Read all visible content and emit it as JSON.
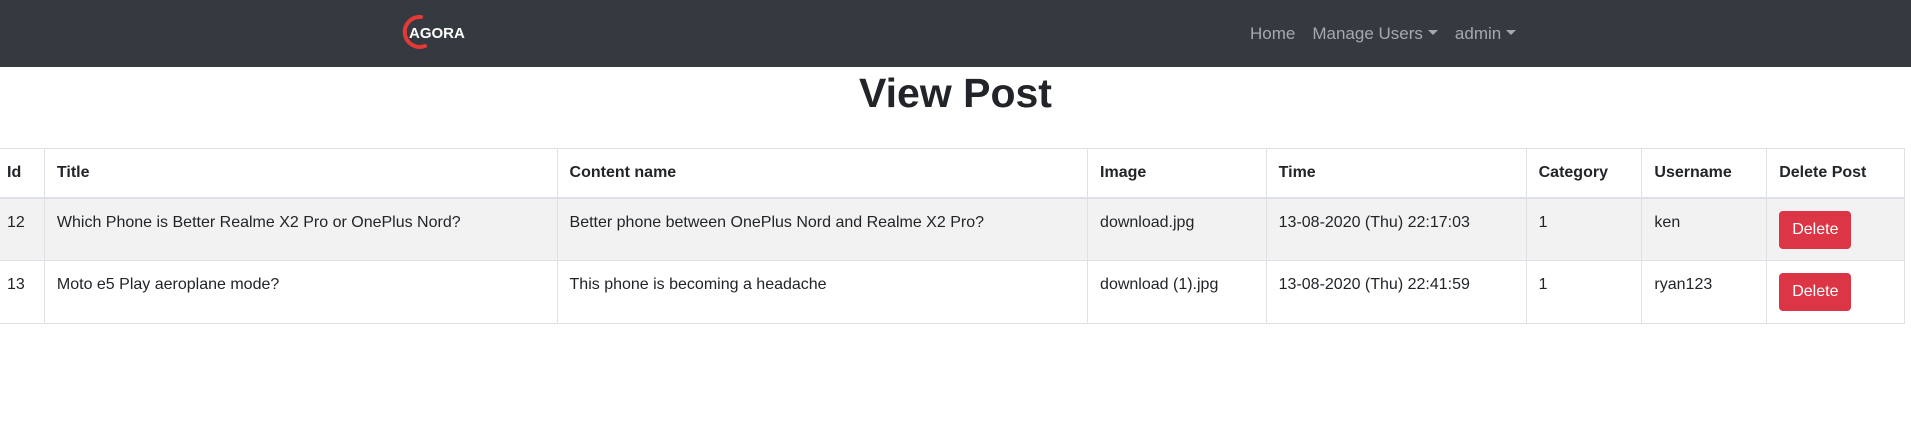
{
  "nav": {
    "brand": "AGORA",
    "links": [
      {
        "label": "Home",
        "dropdown": false
      },
      {
        "label": "Manage Users",
        "dropdown": true
      },
      {
        "label": "admin",
        "dropdown": true
      }
    ]
  },
  "page": {
    "title": "View Post"
  },
  "table": {
    "headers": [
      "Id",
      "Title",
      "Content name",
      "Image",
      "Time",
      "Category",
      "Username",
      "Delete Post"
    ],
    "rows": [
      {
        "id": "12",
        "title": "Which Phone is Better Realme X2 Pro or OnePlus Nord?",
        "content_name": "Better phone between OnePlus Nord and Realme X2 Pro?",
        "image": "download.jpg",
        "time": "13-08-2020 (Thu) 22:17:03",
        "category": "1",
        "username": "ken",
        "action_label": "Delete"
      },
      {
        "id": "13",
        "title": "Moto e5 Play aeroplane mode?",
        "content_name": "This phone is becoming a headache",
        "image": "download (1).jpg",
        "time": "13-08-2020 (Thu) 22:41:59",
        "category": "1",
        "username": "ryan123",
        "action_label": "Delete"
      }
    ]
  },
  "colors": {
    "navbar_bg": "#343a40",
    "nav_text": "#a5a9ad",
    "danger": "#dc3545",
    "logo_ring": "#e53935"
  }
}
